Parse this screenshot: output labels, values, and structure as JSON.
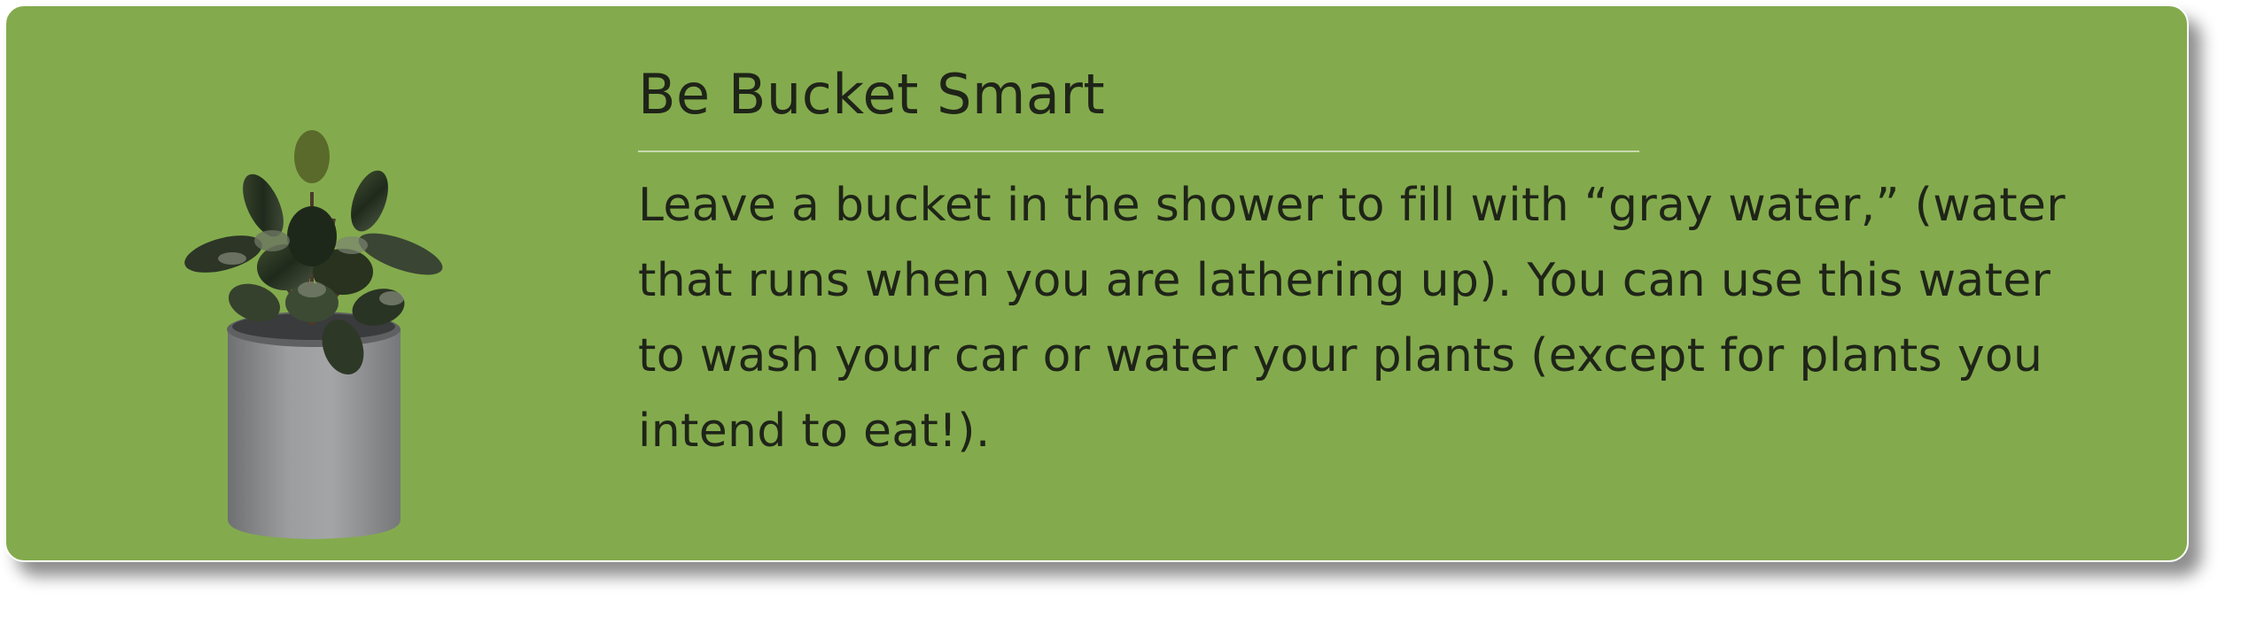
{
  "card": {
    "title": "Be Bucket Smart",
    "body": "Leave a bucket in the shower to fill with “gray water,” (water that runs when you are lathering up). You can use this water to wash your car or water your plants (except for plants you intend to eat!).",
    "image_icon": "potted-plant-icon",
    "colors": {
      "background": "#83ab4d",
      "text": "#1f2418",
      "divider": "#c8dcb0"
    }
  }
}
